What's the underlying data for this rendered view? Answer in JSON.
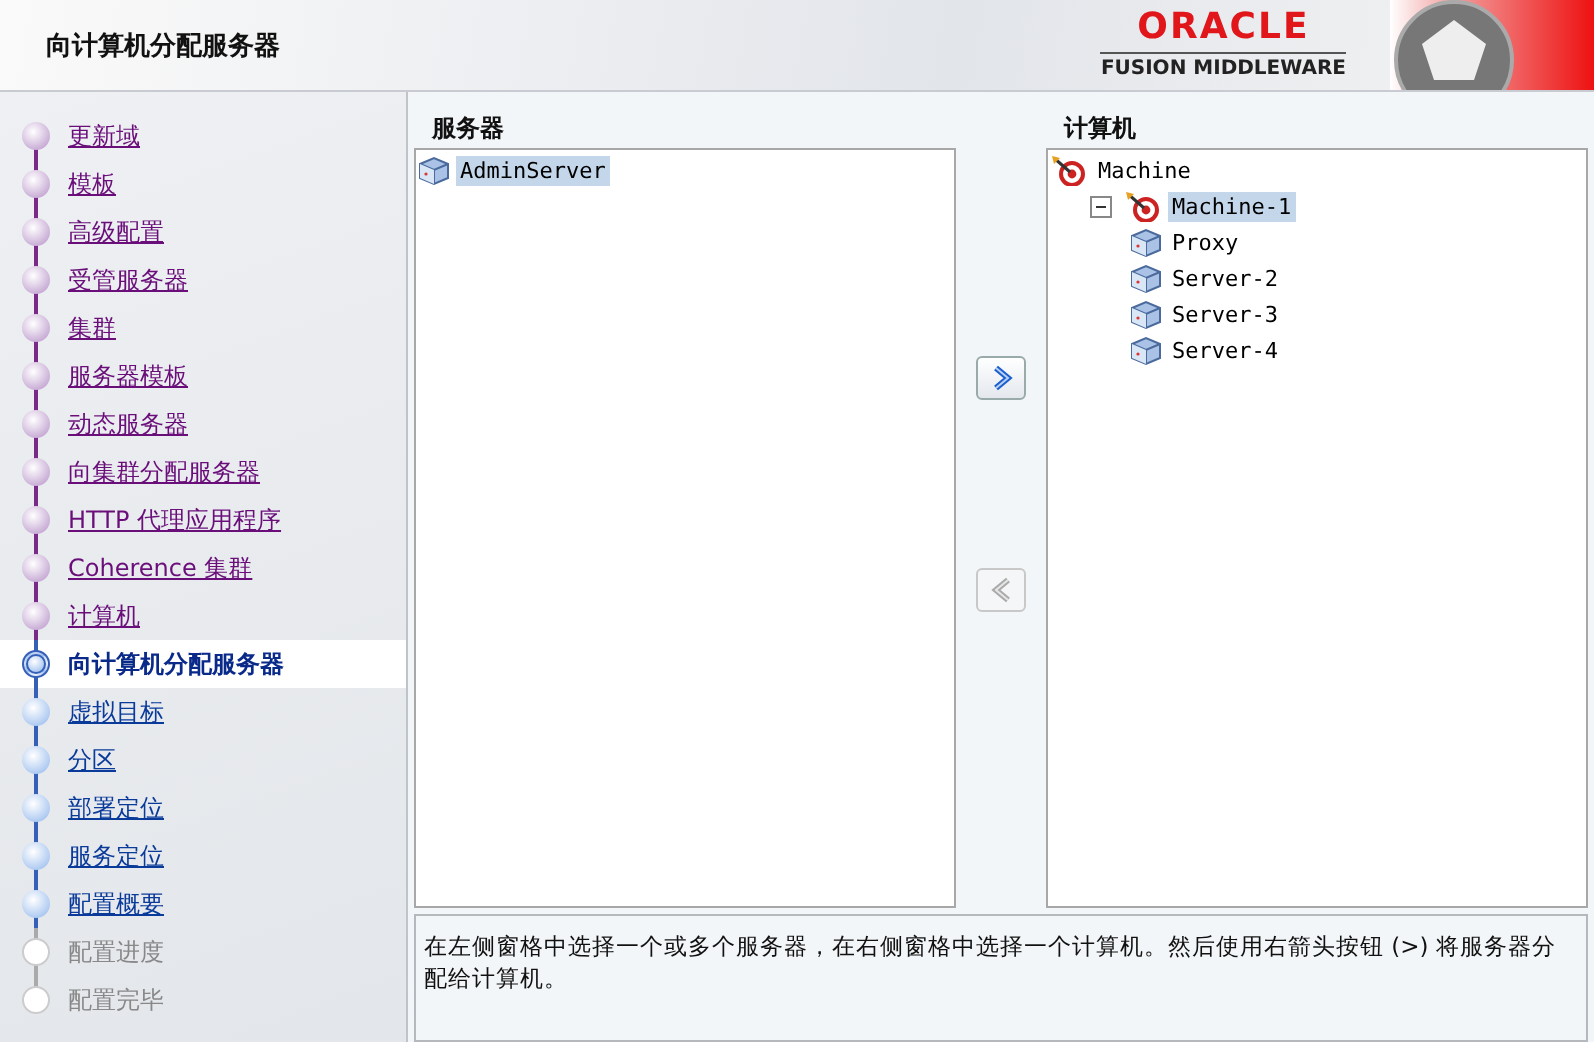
{
  "window": {
    "title": "向计算机分配服务器"
  },
  "logo": {
    "brand": "ORACLE",
    "product": "FUSION MIDDLEWARE"
  },
  "steps": [
    {
      "label": "更新域",
      "kind": "visited"
    },
    {
      "label": "模板",
      "kind": "visited"
    },
    {
      "label": "高级配置",
      "kind": "visited"
    },
    {
      "label": "受管服务器",
      "kind": "visited"
    },
    {
      "label": "集群",
      "kind": "visited"
    },
    {
      "label": "服务器模板",
      "kind": "visited"
    },
    {
      "label": "动态服务器",
      "kind": "visited"
    },
    {
      "label": "向集群分配服务器",
      "kind": "visited"
    },
    {
      "label": "HTTP 代理应用程序",
      "kind": "visited"
    },
    {
      "label": "Coherence 集群",
      "kind": "visited"
    },
    {
      "label": "计算机",
      "kind": "visited"
    },
    {
      "label": "向计算机分配服务器",
      "kind": "current"
    },
    {
      "label": "虚拟目标",
      "kind": "pending"
    },
    {
      "label": "分区",
      "kind": "pending"
    },
    {
      "label": "部署定位",
      "kind": "pending"
    },
    {
      "label": "服务定位",
      "kind": "pending"
    },
    {
      "label": "配置概要",
      "kind": "pending"
    },
    {
      "label": "配置进度",
      "kind": "disabled"
    },
    {
      "label": "配置完毕",
      "kind": "disabled"
    }
  ],
  "servers": {
    "heading": "服务器",
    "items": [
      {
        "label": "AdminServer",
        "selected": true
      }
    ]
  },
  "buttons": [
    {
      "kind": "right",
      "disabled": false
    },
    {
      "kind": "left",
      "disabled": true
    }
  ],
  "machines": {
    "heading": "计算机",
    "tree": [
      {
        "label": "Machine",
        "kind": "machine",
        "selected": false,
        "children": [
          {
            "label": "Machine-1",
            "kind": "machine",
            "selected": true,
            "expanded": true,
            "children": [
              {
                "label": "Proxy",
                "kind": "server",
                "selected": false
              },
              {
                "label": "Server-2",
                "kind": "server",
                "selected": false
              },
              {
                "label": "Server-3",
                "kind": "server",
                "selected": false
              },
              {
                "label": "Server-4",
                "kind": "server",
                "selected": false
              }
            ]
          }
        ]
      }
    ]
  },
  "description": "在左侧窗格中选择一个或多个服务器，在右侧窗格中选择一个计算机。然后使用右箭头按钮 (>) 将服务器分配给计算机。"
}
